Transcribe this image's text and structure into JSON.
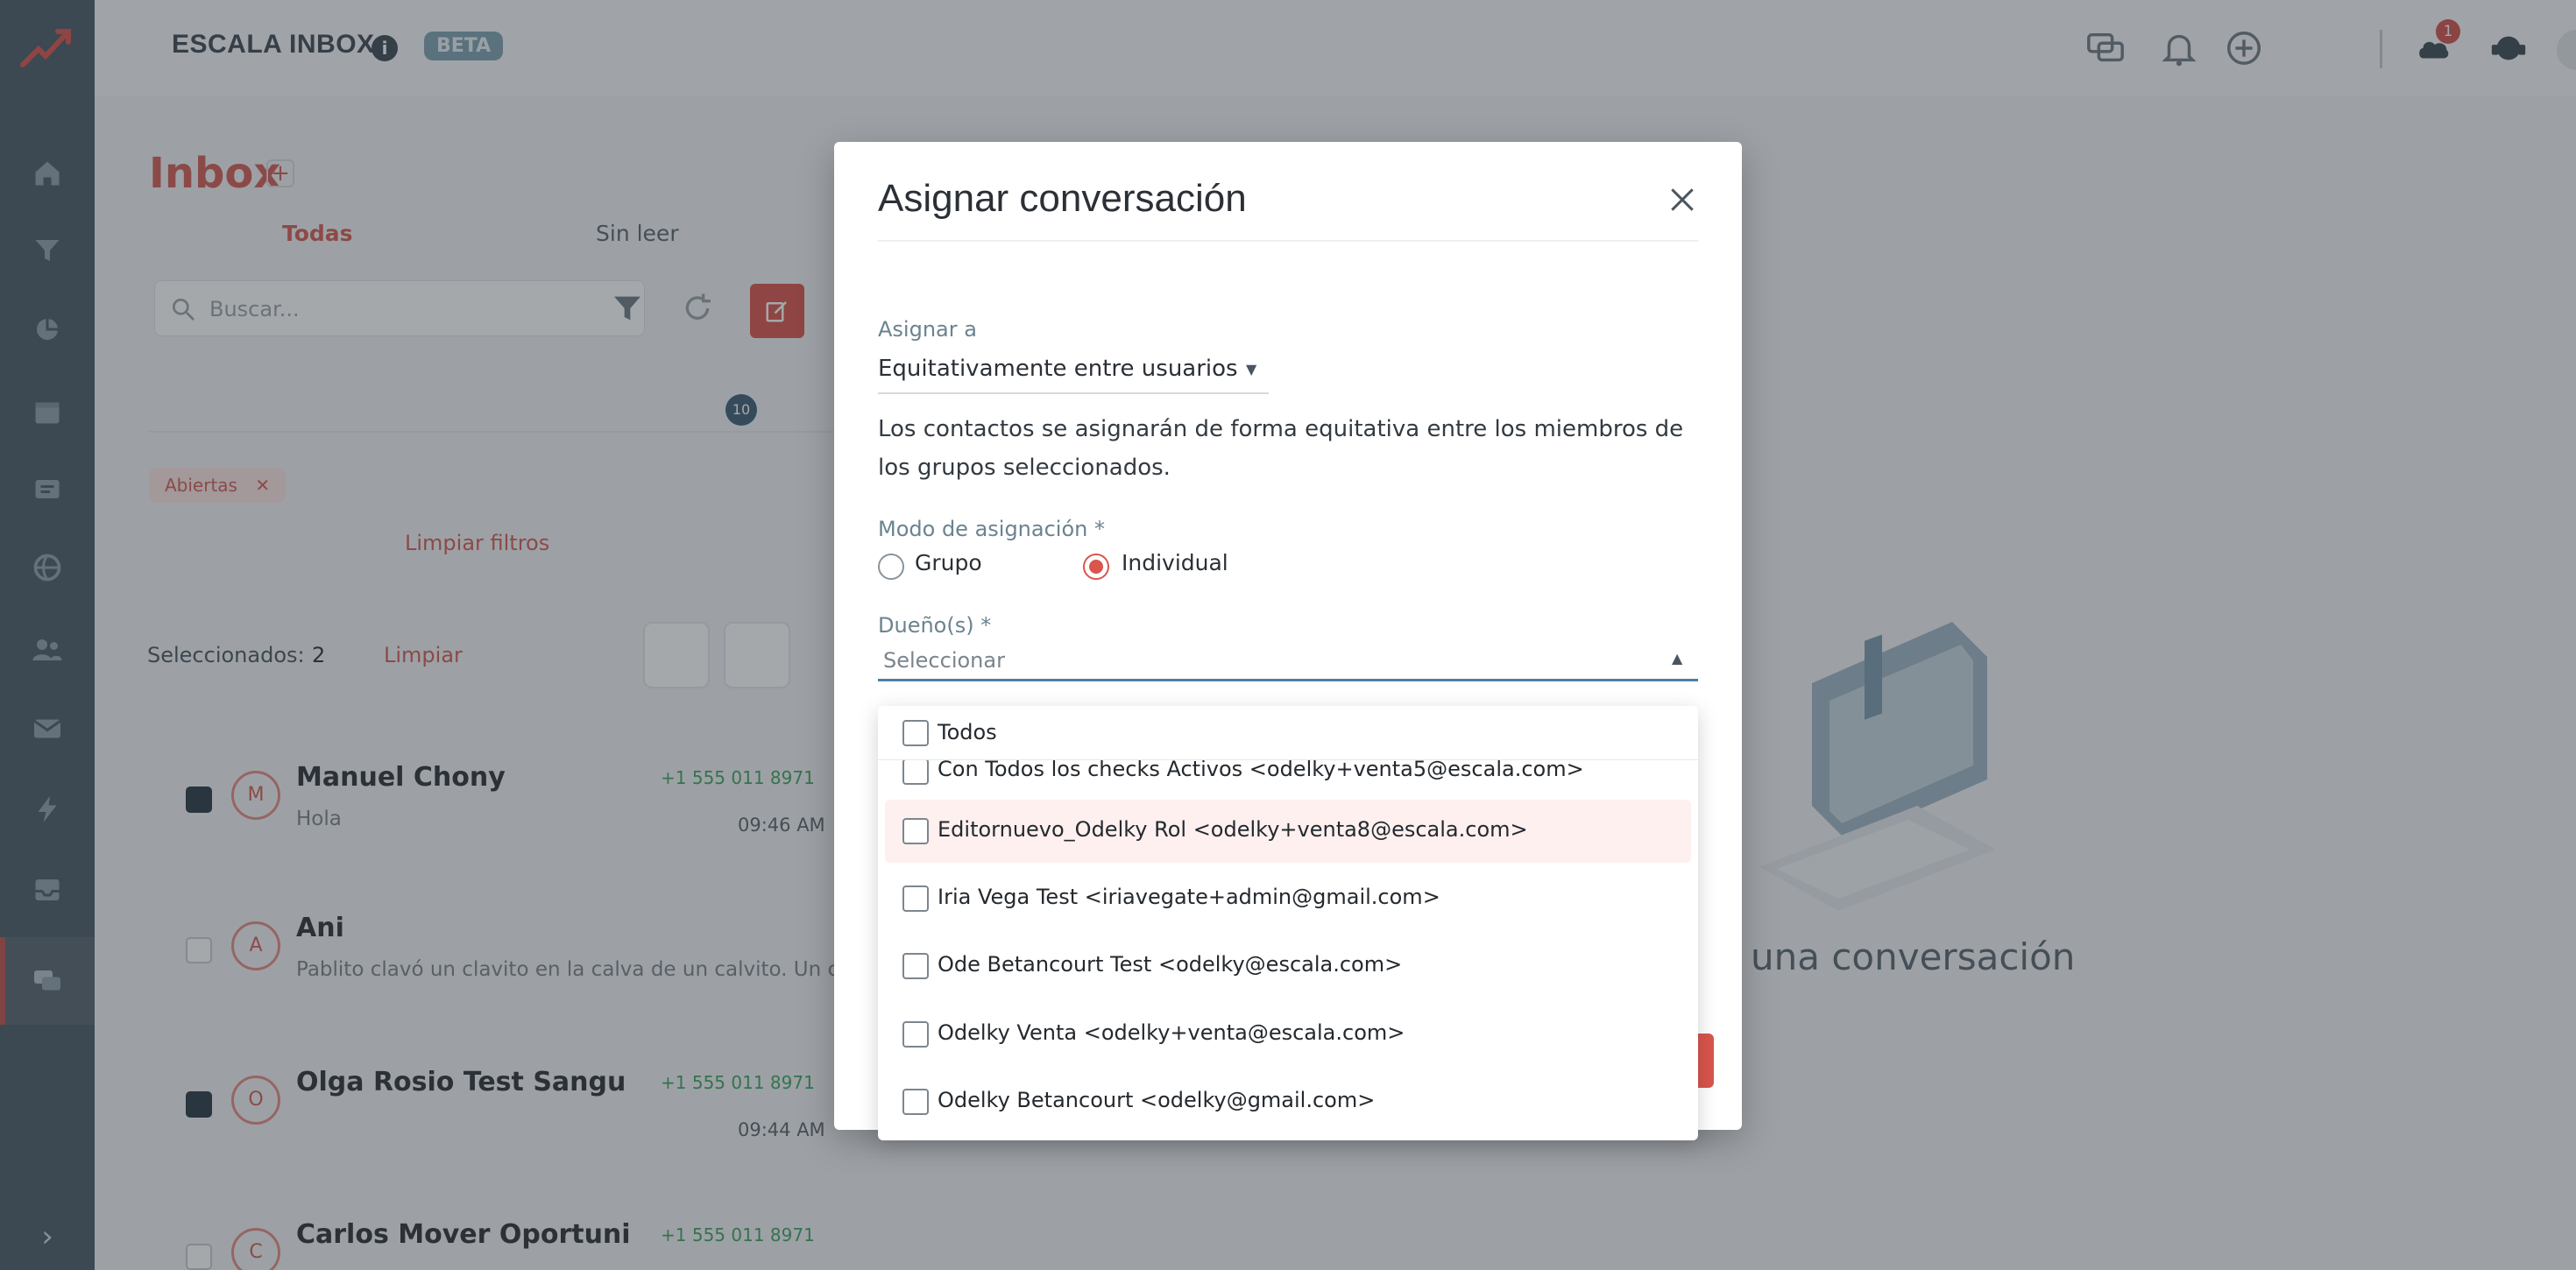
{
  "header": {
    "app_title": "ESCALA INBOX",
    "info_icon": "i",
    "beta_label": "BETA",
    "notification_count": "1"
  },
  "sidebar": {
    "items": [
      "home-icon",
      "funnel-icon",
      "chart-icon",
      "calendar-icon",
      "message-icon",
      "globe-icon",
      "users-icon",
      "mail-icon",
      "bolt-icon",
      "inbox-icon",
      "chat-icon"
    ],
    "expand_icon": "›"
  },
  "main": {
    "title": "Inbox",
    "title_plus": "+",
    "search_placeholder": "Buscar...",
    "tabs": [
      {
        "label": "Todas"
      },
      {
        "label": "Sin leer"
      }
    ],
    "unread_count": "10",
    "filter_chip": "Abiertas",
    "filter_chip_close": "✕",
    "clear_filters": "Limpiar filtros",
    "selected_label": "Seleccionados:",
    "selected_count": "2",
    "selected_clear": "Limpiar",
    "conversations": [
      {
        "initial": "M",
        "name": "Manuel Chony",
        "message": "Hola",
        "phone": "+1 555 011 8971",
        "time": "09:46 AM",
        "checked": true
      },
      {
        "initial": "A",
        "name": "Ani",
        "message": "Pablito clavó un clavito en la calva de un calvito. Un clavito",
        "phone": "",
        "time": "",
        "checked": false
      },
      {
        "initial": "O",
        "name": "Olga Rosio Test Sangu",
        "message": "",
        "phone": "+1 555 011 8971",
        "time": "09:44 AM",
        "checked": true
      },
      {
        "initial": "C",
        "name": "Carlos Mover Oportuni",
        "message": "",
        "phone": "+1 555 011 8971",
        "time": "",
        "checked": false
      }
    ],
    "empty_state": "una conversación"
  },
  "modal": {
    "title": "Asignar conversación",
    "assign_label": "Asignar a",
    "assign_value": "Equitativamente entre usuarios",
    "description": "Los contactos se asignarán de forma equitativa entre los miembros de los grupos seleccionados.",
    "mode_label": "Modo de asignación *",
    "mode_options": [
      {
        "label": "Grupo",
        "selected": false
      },
      {
        "label": "Individual",
        "selected": true
      }
    ],
    "owners_label": "Dueño(s) *",
    "owners_placeholder": "Seleccionar"
  },
  "dropdown": {
    "select_all_label": "Todos",
    "options": [
      {
        "label": "Con Todos los checks Activos <odelky+venta5@escala.com>",
        "highlighted": false
      },
      {
        "label": "Editornuevo_Odelky Rol <odelky+venta8@escala.com>",
        "highlighted": true
      },
      {
        "label": "Iria Vega Test <iriavegate+admin@gmail.com>",
        "highlighted": false
      },
      {
        "label": "Ode Betancourt Test <odelky@escala.com>",
        "highlighted": false
      },
      {
        "label": "Odelky Venta <odelky+venta@escala.com>",
        "highlighted": false
      },
      {
        "label": "Odelky Betancourt <odelky@gmail.com>",
        "highlighted": false
      }
    ]
  },
  "colors": {
    "accent": "#d9554d",
    "sidebar": "#4a5a66",
    "overlay": "rgba(40,48,56,0.42)"
  }
}
